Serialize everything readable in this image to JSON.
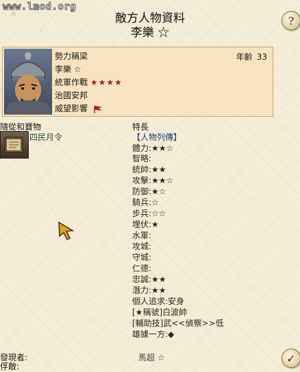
{
  "watermark": "www.lmod.org",
  "header": {
    "title": "敵方人物資料",
    "subtitle": "李樂 ☆"
  },
  "buttons": {
    "help_label": "?",
    "ok_label": "✓"
  },
  "profile": {
    "force_label": "勢力稱梁",
    "name": "李樂 ☆",
    "command_label": "統軍作戰",
    "command_stars": "★★★★",
    "governance_label": "治國安邦",
    "prestige_label": "威望影響",
    "age_label": "年齡",
    "age_value": "33"
  },
  "followers": {
    "heading": "隨從和寶物",
    "item_name": "四民月令"
  },
  "traits": {
    "heading": "特長",
    "items": [
      "【人物列傳】",
      "體力:★★☆",
      "智略:",
      "統帥:★★",
      "攻擊:★★☆",
      "防御:★☆",
      "騎兵:☆",
      "步兵:☆☆",
      "埋伏:★",
      "水軍:",
      "攻城:",
      "守城:",
      "仁德:",
      "忠誠:★★",
      "潛力:★★",
      "個人追求:安身",
      "[★稱號]白波帥",
      "[輔助技]武<<偵察>>低",
      "雄據一方:◆"
    ]
  },
  "footer": {
    "discoverer_label": "發現者:",
    "capture_label": "俘敵:",
    "discoverer_value": "馬超 ☆"
  }
}
